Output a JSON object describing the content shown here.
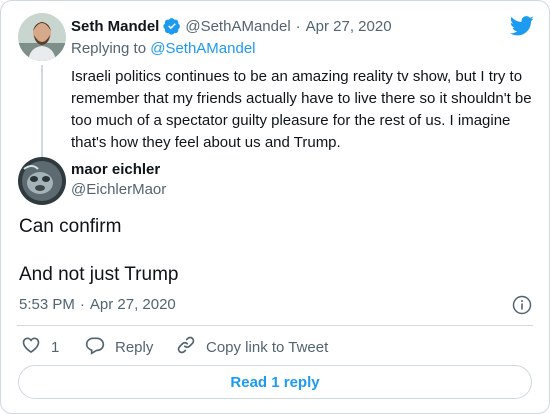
{
  "parent_tweet": {
    "author_name": "Seth Mandel",
    "handle": "@SethAMandel",
    "separator": "·",
    "date": "Apr 27, 2020",
    "replying_prefix": "Replying to ",
    "replying_handle": "@SethAMandel",
    "text": "Israeli politics continues to be an amazing reality tv show, but I try to remember that my friends actually have to live there so it shouldn't be too much of a spectator guilty pleasure for the rest of us. I imagine that's how they feel about us and Trump."
  },
  "tweet": {
    "author_name": "maor eichler",
    "handle": "@EichlerMaor",
    "line1": "Can confirm",
    "line2": "And not just Trump",
    "time": "5:53 PM",
    "separator": "·",
    "date": "Apr 27, 2020",
    "like_count": "1",
    "reply_label": "Reply",
    "copy_link_label": "Copy link to Tweet",
    "read_replies_label": "Read 1 reply"
  },
  "icons": {
    "logo": "twitter-bird-icon",
    "verified": "verified-badge-icon",
    "info": "info-icon",
    "like": "heart-icon",
    "reply": "reply-bubble-icon",
    "copy_link": "link-icon"
  },
  "colors": {
    "accent": "#1d9bf0",
    "text": "#0f1419",
    "muted": "#536471",
    "border": "#cfd9de"
  }
}
